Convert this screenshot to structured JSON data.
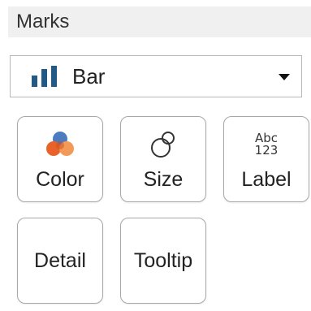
{
  "panel": {
    "title": "Marks"
  },
  "mark_type": {
    "icon": "bar-chart-icon",
    "selected": "Bar",
    "accent_color": "#215a86"
  },
  "cards": [
    {
      "label": "Color",
      "icon": "color-circles-icon",
      "colors": [
        "#4a7cbf",
        "#e8622a",
        "#f39a58"
      ]
    },
    {
      "label": "Size",
      "icon": "size-circles-icon"
    },
    {
      "label": "Label",
      "icon": "abc-123-icon",
      "icon_text_top": "Abc",
      "icon_text_bottom": "123"
    },
    {
      "label": "Detail"
    },
    {
      "label": "Tooltip"
    }
  ]
}
